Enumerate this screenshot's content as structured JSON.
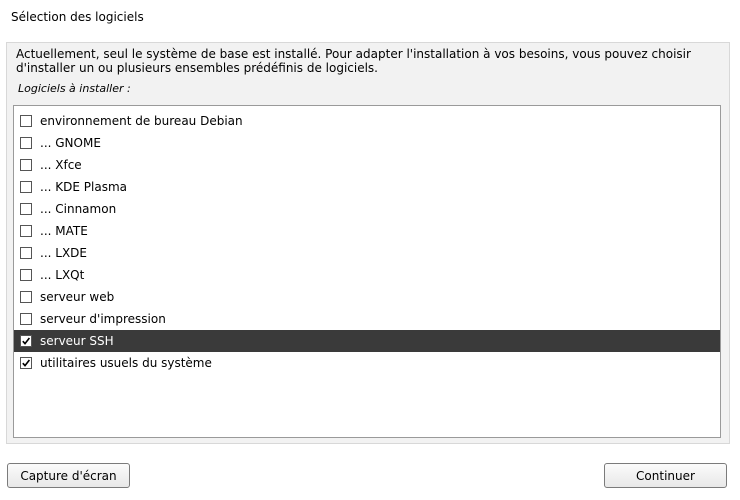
{
  "header": {
    "title": "Sélection des logiciels"
  },
  "panel": {
    "description": "Actuellement, seul le système de base est installé. Pour adapter l'installation à vos besoins, vous pouvez choisir d'installer un ou plusieurs ensembles prédéfinis de logiciels.",
    "list_caption": "Logiciels à installer :"
  },
  "software_list": {
    "items": [
      {
        "label": "environnement de bureau Debian",
        "checked": false,
        "selected": false
      },
      {
        "label": "... GNOME",
        "checked": false,
        "selected": false
      },
      {
        "label": "... Xfce",
        "checked": false,
        "selected": false
      },
      {
        "label": "... KDE Plasma",
        "checked": false,
        "selected": false
      },
      {
        "label": "... Cinnamon",
        "checked": false,
        "selected": false
      },
      {
        "label": "... MATE",
        "checked": false,
        "selected": false
      },
      {
        "label": "... LXDE",
        "checked": false,
        "selected": false
      },
      {
        "label": "... LXQt",
        "checked": false,
        "selected": false
      },
      {
        "label": "serveur web",
        "checked": false,
        "selected": false
      },
      {
        "label": "serveur d'impression",
        "checked": false,
        "selected": false
      },
      {
        "label": "serveur SSH",
        "checked": true,
        "selected": true
      },
      {
        "label": "utilitaires usuels du système",
        "checked": true,
        "selected": false
      }
    ]
  },
  "buttons": {
    "screenshot_label": "Capture d'écran",
    "continue_label": "Continuer"
  },
  "colors": {
    "selected_row": "#3a3a3a",
    "panel_background": "#f2f2f2"
  }
}
